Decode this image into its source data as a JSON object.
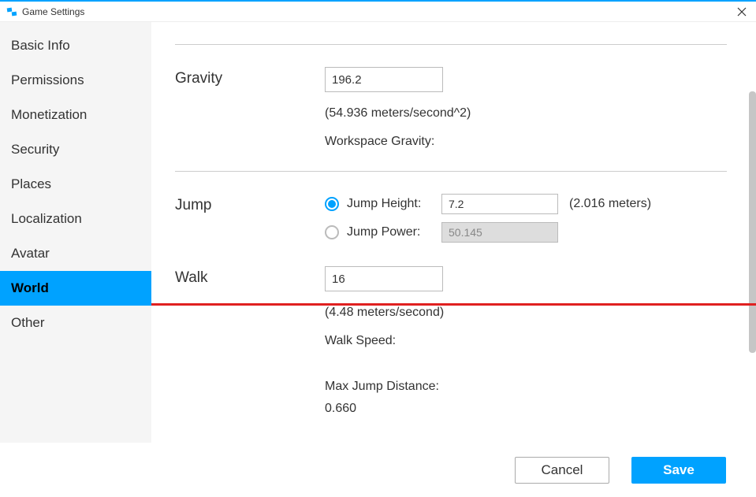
{
  "window": {
    "title": "Game Settings"
  },
  "sidebar": {
    "items": [
      {
        "label": "Basic Info",
        "selected": false
      },
      {
        "label": "Permissions",
        "selected": false
      },
      {
        "label": "Monetization",
        "selected": false
      },
      {
        "label": "Security",
        "selected": false
      },
      {
        "label": "Places",
        "selected": false
      },
      {
        "label": "Localization",
        "selected": false
      },
      {
        "label": "Avatar",
        "selected": false
      },
      {
        "label": "World",
        "selected": true
      },
      {
        "label": "Other",
        "selected": false
      }
    ]
  },
  "gravity": {
    "label": "Gravity",
    "value": "196.2",
    "hint": "(54.936 meters/second^2)",
    "workspace_label": "Workspace Gravity:"
  },
  "jump": {
    "label": "Jump",
    "height_label": "Jump Height:",
    "height_value": "7.2",
    "height_aside": "(2.016 meters)",
    "power_label": "Jump Power:",
    "power_value": "50.145",
    "selected": "height"
  },
  "walk": {
    "label": "Walk",
    "value": "16",
    "hint": "(4.48 meters/second)",
    "speed_label": "Walk Speed:",
    "max_jump_label": "Max Jump Distance:",
    "max_jump_partial": "0.660"
  },
  "footer": {
    "cancel": "Cancel",
    "save": "Save"
  }
}
